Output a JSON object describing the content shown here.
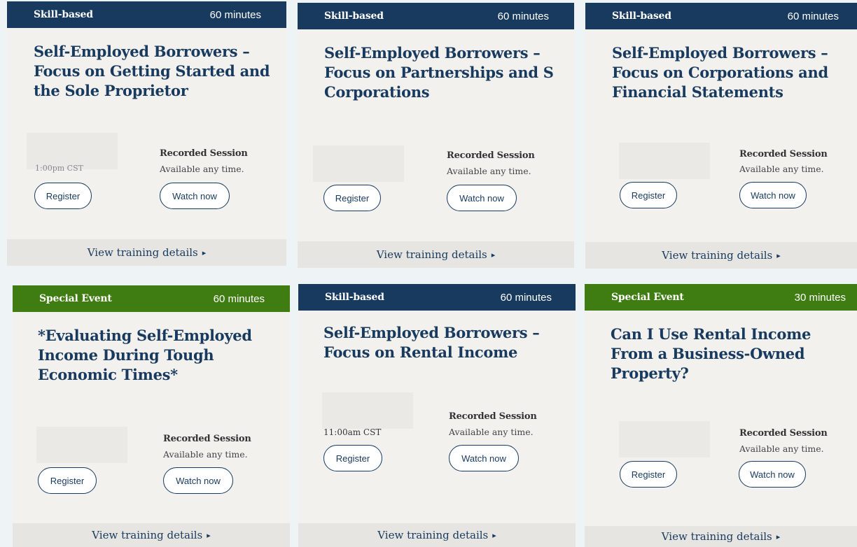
{
  "footer_link": "View training details",
  "footer_arrow": "▸",
  "cards": [
    {
      "category": "Skill-based",
      "duration": "60 minutes",
      "title": "Self-Employed Borrowers – Focus on Getting Started and the Sole Proprietor",
      "date_time": "1:00pm CST",
      "recorded_title": "Recorded Session",
      "recorded_sub": "Available any time.",
      "register": "Register",
      "watch": "Watch now"
    },
    {
      "category": "Skill-based",
      "duration": "60 minutes",
      "title": "Self-Employed Borrowers – Focus on Partnerships and S Corporations",
      "date_time": "",
      "recorded_title": "Recorded Session",
      "recorded_sub": "Available any time.",
      "register": "Register",
      "watch": "Watch now"
    },
    {
      "category": "Skill-based",
      "duration": "60 minutes",
      "title": "Self-Employed Borrowers – Focus on Corporations and Financial Statements",
      "date_time": "",
      "recorded_title": "Recorded Session",
      "recorded_sub": "Available any time.",
      "register": "Register",
      "watch": "Watch now"
    },
    {
      "category": "Special Event",
      "duration": "60 minutes",
      "title": "*Evaluating Self-Employed Income During Tough Economic Times*",
      "date_time": "",
      "recorded_title": "Recorded Session",
      "recorded_sub": "Available any time.",
      "register": "Register",
      "watch": "Watch now"
    },
    {
      "category": "Skill-based",
      "duration": "60 minutes",
      "title": "Self-Employed Borrowers – Focus on Rental Income",
      "date_time": "11:00am CST",
      "recorded_title": "Recorded Session",
      "recorded_sub": "Available any time.",
      "register": "Register",
      "watch": "Watch now"
    },
    {
      "category": "Special Event",
      "duration": "30 minutes",
      "title": "Can I Use Rental Income From a Business-Owned Property?",
      "date_time": "",
      "recorded_title": "Recorded Session",
      "recorded_sub": "Available any time.",
      "register": "Register",
      "watch": "Watch now"
    }
  ],
  "colors": {
    "navy": "#173a5e",
    "green": "#3f7d12",
    "card_bg": "#f3f1ee",
    "footer_bg": "#e7e5e2"
  }
}
